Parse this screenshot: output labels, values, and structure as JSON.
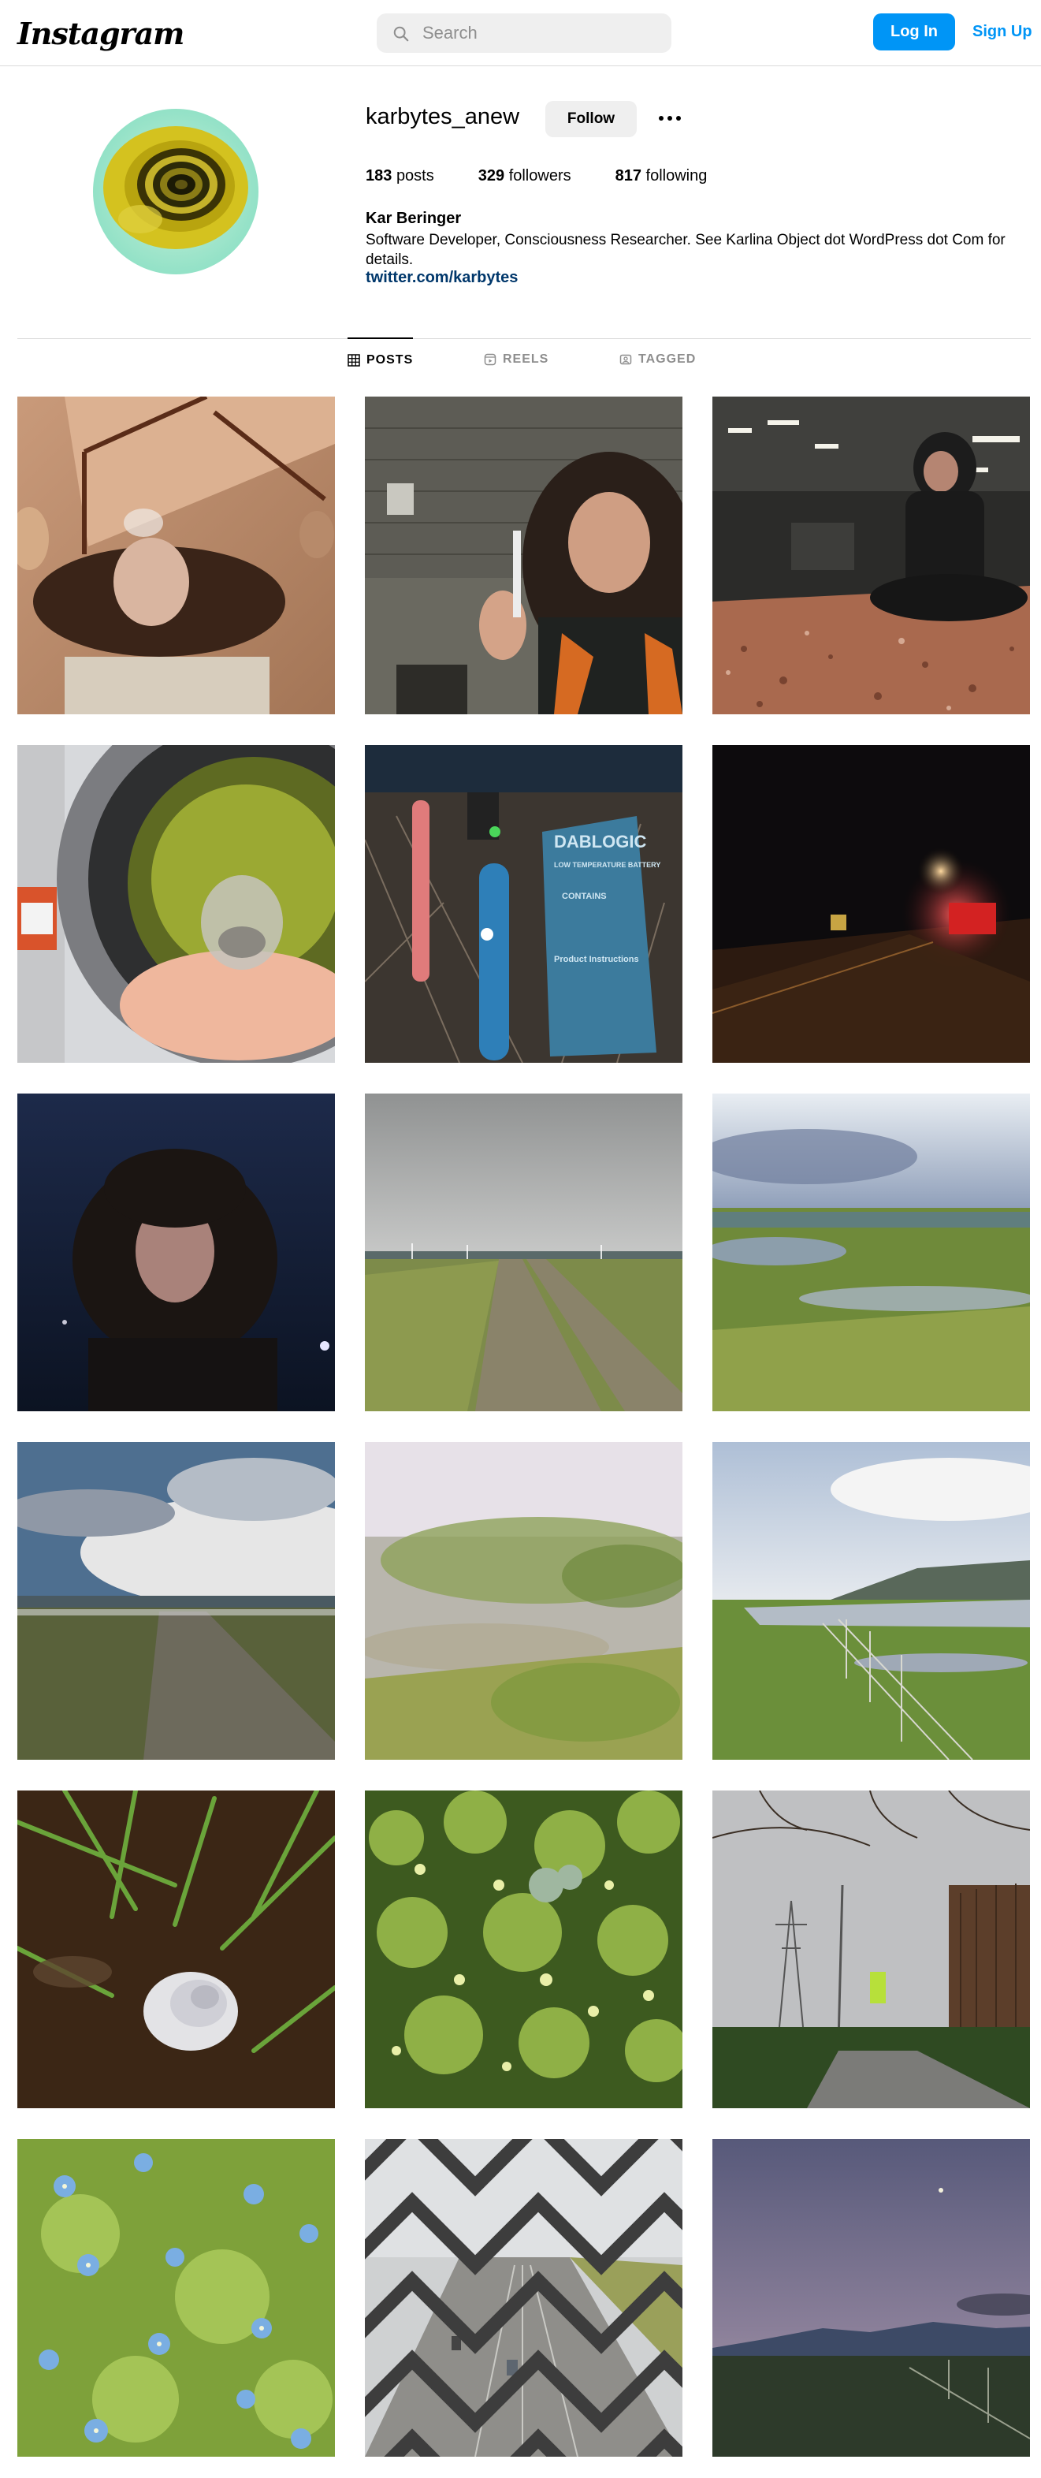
{
  "app": {
    "logo_text": "Instagram"
  },
  "search": {
    "placeholder": "Search"
  },
  "nav": {
    "login_label": "Log In",
    "signup_label": "Sign Up"
  },
  "profile": {
    "username": "karbytes_anew",
    "follow_label": "Follow",
    "stats": {
      "posts_count": "183",
      "posts_label": "posts",
      "followers_count": "329",
      "followers_label": "followers",
      "following_count": "817",
      "following_label": "following"
    },
    "name": "Kar Beringer",
    "bio": "Software Developer, Consciousness Researcher. See Karlina Object dot WordPress dot Com for details.",
    "link": "twitter.com/karbytes"
  },
  "tabs": [
    {
      "label": "POSTS",
      "active": true,
      "icon": "grid-icon"
    },
    {
      "label": "REELS",
      "active": false,
      "icon": "reels-icon"
    },
    {
      "label": "TAGGED",
      "active": false,
      "icon": "tagged-icon"
    }
  ],
  "colors": {
    "accent": "#0095f6",
    "link": "#00376b",
    "border": "#dbdbdb",
    "button_gray": "#efefef"
  },
  "posts": [
    {
      "subject": "person-ceiling-selfie"
    },
    {
      "subject": "person-holding-vape"
    },
    {
      "subject": "person-sitting-station"
    },
    {
      "subject": "laundry-machine-jar"
    },
    {
      "subject": "battery-device-box"
    },
    {
      "subject": "night-traffic-lights"
    },
    {
      "subject": "person-night-selfie"
    },
    {
      "subject": "cloudy-path-field"
    },
    {
      "subject": "wetland-marsh"
    },
    {
      "subject": "cloudy-sky-field"
    },
    {
      "subject": "grass-dunes-blurry"
    },
    {
      "subject": "marsh-fence-hills"
    },
    {
      "subject": "snail-shell-grass"
    },
    {
      "subject": "green-plants"
    },
    {
      "subject": "power-tower-street"
    },
    {
      "subject": "blue-flowers"
    },
    {
      "subject": "chainlink-highway"
    },
    {
      "subject": "dusk-sky-hills"
    }
  ],
  "overlay_text": {
    "battery_brand": "DABLOGIC",
    "battery_label": "LOW TEMPERATURE BATTERY",
    "battery_contains": "CONTAINS",
    "battery_instructions": "Product Instructions"
  }
}
